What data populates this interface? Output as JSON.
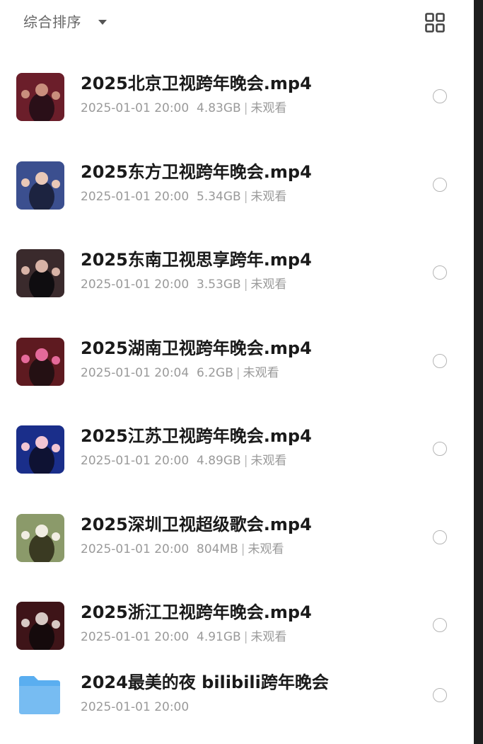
{
  "header": {
    "sort_label": "综合排序",
    "sort_caret_icon": "caret-down-icon",
    "view_toggle_icon": "grid-view-icon"
  },
  "files": [
    {
      "title": "2025北京卫视跨年晚会.mp4",
      "date": "2025-01-01 20:00",
      "size": "4.83GB",
      "status": "未观看",
      "thumb_colors": [
        "#6b1e2a",
        "#c98f7d",
        "#2a0f18"
      ]
    },
    {
      "title": "2025东方卫视跨年晚会.mp4",
      "date": "2025-01-01 20:00",
      "size": "5.34GB",
      "status": "未观看",
      "thumb_colors": [
        "#3b4f8f",
        "#e9c8b7",
        "#1c2340"
      ]
    },
    {
      "title": "2025东南卫视思享跨年.mp4",
      "date": "2025-01-01 20:00",
      "size": "3.53GB",
      "status": "未观看",
      "thumb_colors": [
        "#3a2a2c",
        "#d8b3a6",
        "#0f0d10"
      ]
    },
    {
      "title": "2025湖南卫视跨年晚会.mp4",
      "date": "2025-01-01 20:04",
      "size": "6.2GB",
      "status": "未观看",
      "thumb_colors": [
        "#5e1a20",
        "#e56a9a",
        "#241013"
      ]
    },
    {
      "title": "2025江苏卫视跨年晚会.mp4",
      "date": "2025-01-01 20:00",
      "size": "4.89GB",
      "status": "未观看",
      "thumb_colors": [
        "#1a2e8a",
        "#f2c6d3",
        "#0e1233"
      ]
    },
    {
      "title": "2025深圳卫视超级歌会.mp4",
      "date": "2025-01-01 20:00",
      "size": "804MB",
      "status": "未观看",
      "thumb_colors": [
        "#8b9a6a",
        "#f1ede3",
        "#3a3a22"
      ]
    },
    {
      "title": "2025浙江卫视跨年晚会.mp4",
      "date": "2025-01-01 20:00",
      "size": "4.91GB",
      "status": "未观看",
      "thumb_colors": [
        "#3e1418",
        "#d7c9c4",
        "#150a0c"
      ]
    }
  ],
  "folder": {
    "title": "2024最美的夜 bilibili跨年晚会",
    "date": "2025-01-01 20:00",
    "icon": "folder-icon",
    "color": "#5aaef0"
  }
}
